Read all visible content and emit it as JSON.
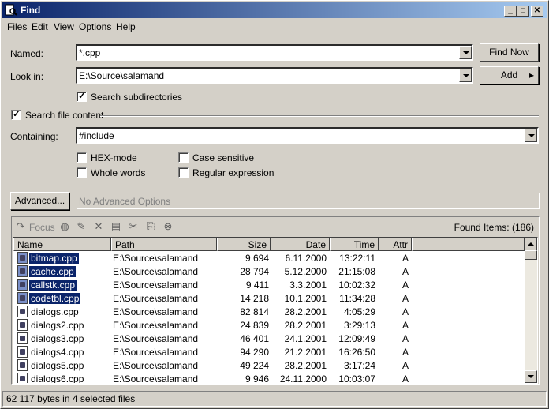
{
  "window": {
    "title": "Find"
  },
  "menu": {
    "items": [
      "Files",
      "Edit",
      "View",
      "Options",
      "Help"
    ]
  },
  "form": {
    "named_label": "Named:",
    "named_value": "*.cpp",
    "lookin_label": "Look in:",
    "lookin_value": "E:\\Source\\salamand",
    "search_subdirs_label": "Search subdirectories",
    "search_file_content_label": "Search file content",
    "containing_label": "Containing:",
    "containing_value": "#include",
    "hex_mode_label": "HEX-mode",
    "case_sensitive_label": "Case sensitive",
    "whole_words_label": "Whole words",
    "regex_label": "Regular expression",
    "advanced_button": "Advanced...",
    "advanced_value": "No Advanced Options",
    "find_now_button": "Find Now",
    "add_button": "Add"
  },
  "toolbar": {
    "focus_label": "Focus",
    "found_items": "Found Items: (186)"
  },
  "columns": [
    "Name",
    "Path",
    "Size",
    "Date",
    "Time",
    "Attr"
  ],
  "rows": [
    {
      "name": "bitmap.cpp",
      "path": "E:\\Source\\salamand",
      "size": "9 694",
      "date": "6.11.2000",
      "time": "13:22:11",
      "attr": "A",
      "selected": true
    },
    {
      "name": "cache.cpp",
      "path": "E:\\Source\\salamand",
      "size": "28 794",
      "date": "5.12.2000",
      "time": "21:15:08",
      "attr": "A",
      "selected": true
    },
    {
      "name": "callstk.cpp",
      "path": "E:\\Source\\salamand",
      "size": "9 411",
      "date": "3.3.2001",
      "time": "10:02:32",
      "attr": "A",
      "selected": true
    },
    {
      "name": "codetbl.cpp",
      "path": "E:\\Source\\salamand",
      "size": "14 218",
      "date": "10.1.2001",
      "time": "11:34:28",
      "attr": "A",
      "selected": true
    },
    {
      "name": "dialogs.cpp",
      "path": "E:\\Source\\salamand",
      "size": "82 814",
      "date": "28.2.2001",
      "time": "4:05:29",
      "attr": "A",
      "selected": false
    },
    {
      "name": "dialogs2.cpp",
      "path": "E:\\Source\\salamand",
      "size": "24 839",
      "date": "28.2.2001",
      "time": "3:29:13",
      "attr": "A",
      "selected": false
    },
    {
      "name": "dialogs3.cpp",
      "path": "E:\\Source\\salamand",
      "size": "46 401",
      "date": "24.1.2001",
      "time": "12:09:49",
      "attr": "A",
      "selected": false
    },
    {
      "name": "dialogs4.cpp",
      "path": "E:\\Source\\salamand",
      "size": "94 290",
      "date": "21.2.2001",
      "time": "16:26:50",
      "attr": "A",
      "selected": false
    },
    {
      "name": "dialogs5.cpp",
      "path": "E:\\Source\\salamand",
      "size": "49 224",
      "date": "28.2.2001",
      "time": "3:17:24",
      "attr": "A",
      "selected": false
    },
    {
      "name": "dialogs6.cpp",
      "path": "E:\\Source\\salamand",
      "size": "9 946",
      "date": "24.11.2000",
      "time": "10:03:07",
      "attr": "A",
      "selected": false
    }
  ],
  "status": {
    "text": "62 117 bytes in 4 selected files"
  },
  "icons": {
    "app": "find-app-icon"
  }
}
